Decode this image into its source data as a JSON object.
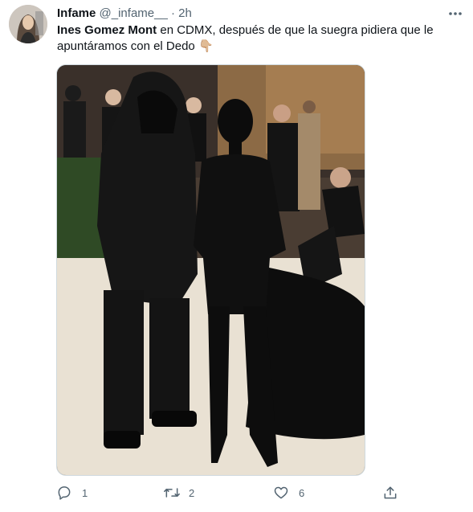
{
  "tweet": {
    "author_name": "Infame",
    "handle": "@_infame__",
    "separator": "·",
    "time": "2h",
    "text_bold": "Ines Gomez Mont",
    "text_rest": " en CDMX, después de que la suegra pidiera que le apuntáramos con el Dedo",
    "emoji": "👇🏼"
  },
  "actions": {
    "replies": "1",
    "retweets": "2",
    "likes": "6"
  },
  "icons": {
    "more": "more-dots-icon",
    "reply": "reply-icon",
    "retweet": "retweet-icon",
    "like": "heart-icon",
    "share": "share-icon"
  },
  "colors": {
    "text_primary": "#0f1419",
    "text_secondary": "#536471"
  }
}
